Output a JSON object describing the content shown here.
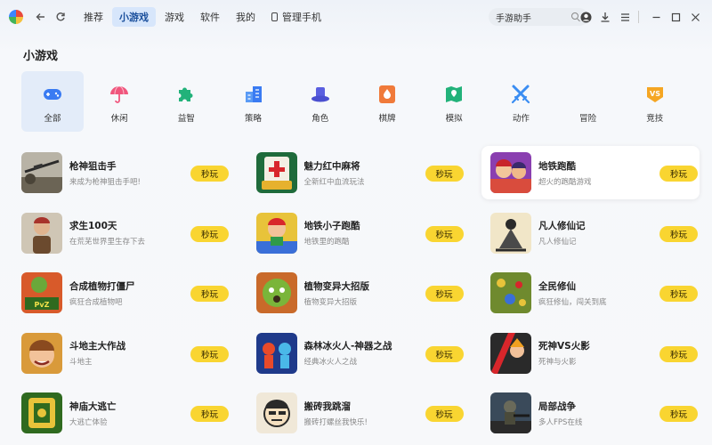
{
  "topbar": {
    "tabs": [
      {
        "label": "推荐"
      },
      {
        "label": "小游戏"
      },
      {
        "label": "游戏"
      },
      {
        "label": "软件"
      },
      {
        "label": "我的"
      },
      {
        "label": "管理手机"
      }
    ],
    "search": {
      "value": "手游助手"
    }
  },
  "section": {
    "title": "小游戏"
  },
  "categories": [
    {
      "label": "全部",
      "icon": "gamepad-icon",
      "color": "#3a7bf2"
    },
    {
      "label": "休闲",
      "icon": "umbrella-icon",
      "color": "#f0567d"
    },
    {
      "label": "益智",
      "icon": "puzzle-icon",
      "color": "#22b27a"
    },
    {
      "label": "策略",
      "icon": "buildings-icon",
      "color": "#3a7bf2"
    },
    {
      "label": "角色",
      "icon": "hat-icon",
      "color": "#5a5fe0"
    },
    {
      "label": "棋牌",
      "icon": "card-suit-icon",
      "color": "#f07a3a"
    },
    {
      "label": "模拟",
      "icon": "map-pin-icon",
      "color": "#22b27a"
    },
    {
      "label": "动作",
      "icon": "crossed-swords-icon",
      "color": "#3a8df2"
    },
    {
      "label": "冒险",
      "icon": "",
      "color": ""
    },
    {
      "label": "竞技",
      "icon": "vs-badge-icon",
      "color": "#f5a623"
    }
  ],
  "play_label": "秒玩",
  "games": [
    [
      {
        "name": "枪神狙击手",
        "desc": "来成为枪神狙击手吧!",
        "thumb": "sniper"
      },
      {
        "name": "魅力红中麻将",
        "desc": "全新红中血流玩法",
        "thumb": "mahjong"
      },
      {
        "name": "地铁跑酷",
        "desc": "超火的跑酷游戏",
        "thumb": "subway"
      }
    ],
    [
      {
        "name": "求生100天",
        "desc": "在荒芜世界里生存下去",
        "thumb": "survival"
      },
      {
        "name": "地铁小子跑酷",
        "desc": "地铁里的跑酷",
        "thumb": "subwayboy"
      },
      {
        "name": "凡人修仙记",
        "desc": "凡人修仙记",
        "thumb": "immortal"
      }
    ],
    [
      {
        "name": "合成植物打僵尸",
        "desc": "疯狂合成植物吧",
        "thumb": "pvz"
      },
      {
        "name": "植物变异大招版",
        "desc": "植物变异大招版",
        "thumb": "plant"
      },
      {
        "name": "全民修仙",
        "desc": "疯狂修仙，闯关到底",
        "thumb": "allimmortal"
      }
    ],
    [
      {
        "name": "斗地主大作战",
        "desc": "斗地主",
        "thumb": "landlord"
      },
      {
        "name": "森林冰火人-神器之战",
        "desc": "经典冰火人之战",
        "thumb": "fireice"
      },
      {
        "name": "死神VS火影",
        "desc": "死神与火影",
        "thumb": "bleach"
      }
    ],
    [
      {
        "name": "神庙大逃亡",
        "desc": "大逃亡体验",
        "thumb": "temple"
      },
      {
        "name": "搬砖我跳溜",
        "desc": "搬砖打螺丝我快乐!",
        "thumb": "brick"
      },
      {
        "name": "局部战争",
        "desc": "多人FPS在线",
        "thumb": "war"
      }
    ]
  ]
}
